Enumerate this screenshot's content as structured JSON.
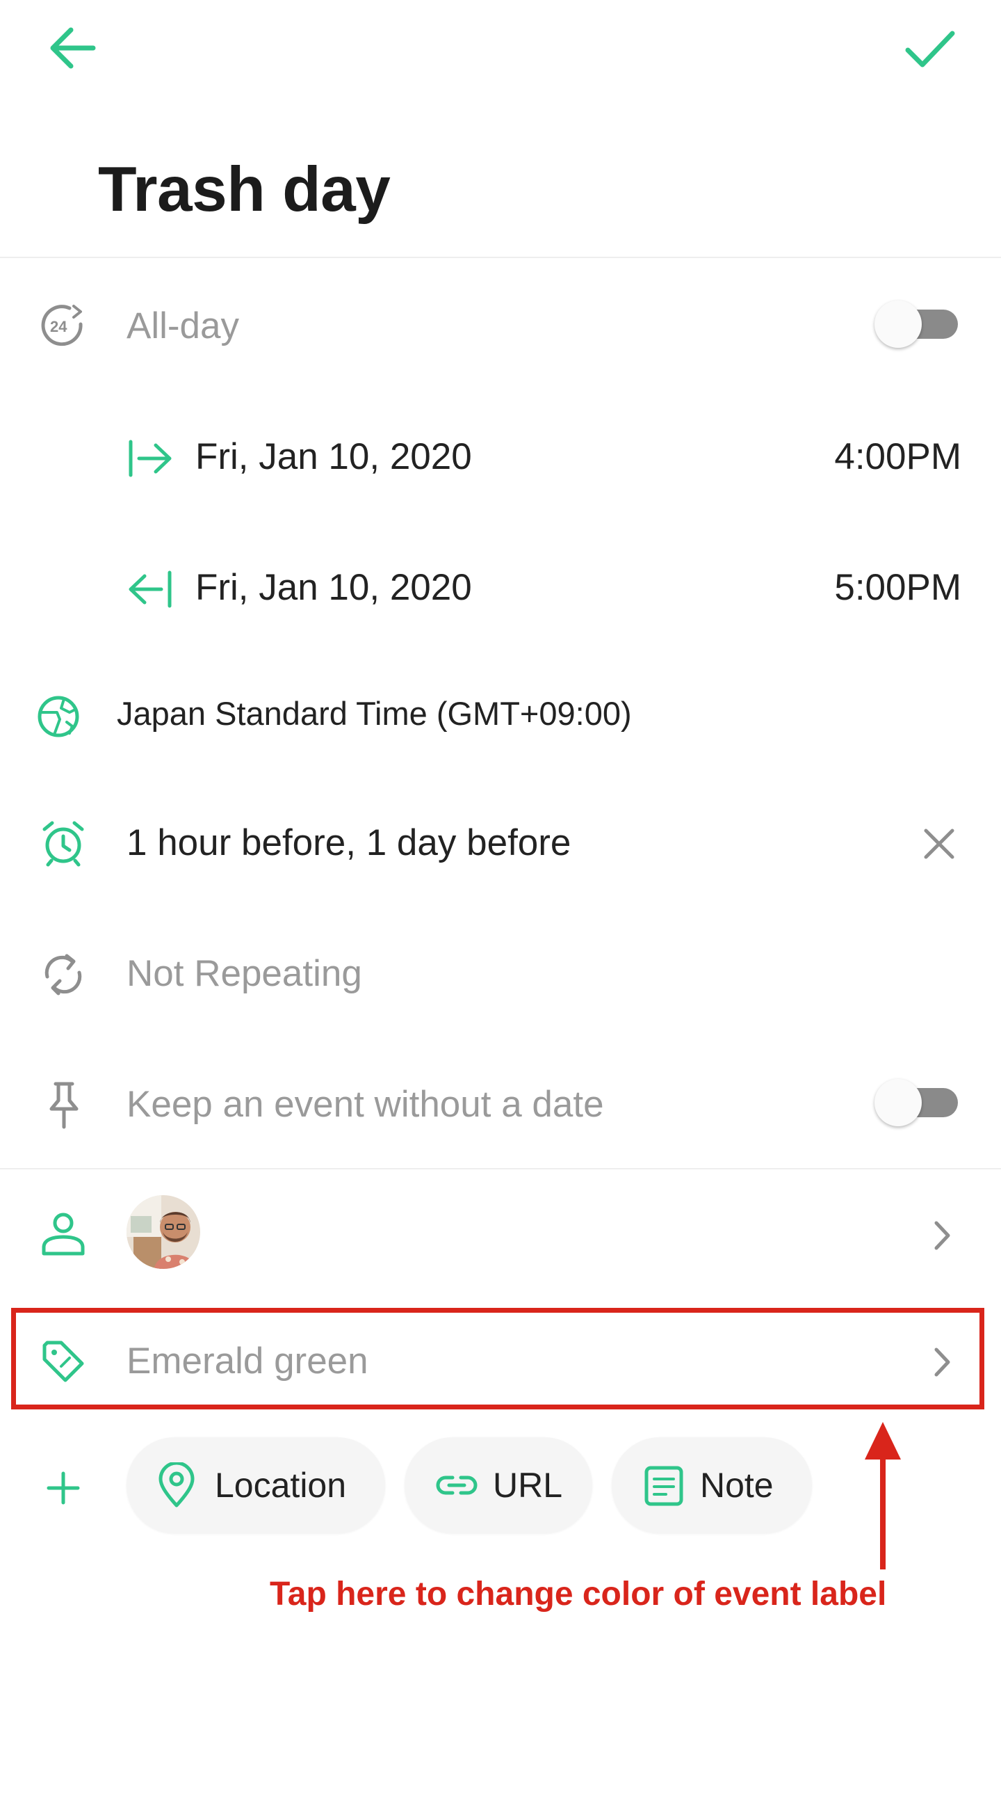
{
  "header": {
    "back_icon": "arrow-left-icon",
    "confirm_icon": "checkmark-icon",
    "title": "Trash day"
  },
  "all_day": {
    "icon": "24h-clock-icon",
    "label": "All-day",
    "toggle_on": false
  },
  "start": {
    "icon": "start-arrow-icon",
    "date": "Fri, Jan 10, 2020",
    "time": "4:00PM"
  },
  "end": {
    "icon": "end-arrow-icon",
    "date": "Fri, Jan 10, 2020",
    "time": "5:00PM"
  },
  "timezone": {
    "icon": "globe-icon",
    "label": "Japan Standard Time (GMT+09:00)"
  },
  "reminder": {
    "icon": "alarm-clock-icon",
    "label": "1 hour before, 1 day before",
    "clear_icon": "close-icon"
  },
  "repeat": {
    "icon": "repeat-icon",
    "label": "Not Repeating"
  },
  "keep_undated": {
    "icon": "pin-icon",
    "label": "Keep an event without a date",
    "toggle_on": false
  },
  "attendees": {
    "icon": "person-icon",
    "avatar": "user-avatar",
    "chevron": "chevron-right-icon"
  },
  "label_color": {
    "icon": "tag-icon",
    "label": "Emerald green",
    "chevron": "chevron-right-icon"
  },
  "add_more": {
    "icon": "plus-icon",
    "chips": [
      {
        "icon": "location-pin-icon",
        "label": "Location"
      },
      {
        "icon": "link-icon",
        "label": "URL"
      },
      {
        "icon": "note-icon",
        "label": "Note"
      }
    ]
  },
  "annotation": {
    "text": "Tap here to change color of event label"
  },
  "colors": {
    "accent": "#2fc58a",
    "gray_icon": "#8e8e8e",
    "annotation_red": "#d9251b",
    "muted_text": "#9a9a9a"
  }
}
